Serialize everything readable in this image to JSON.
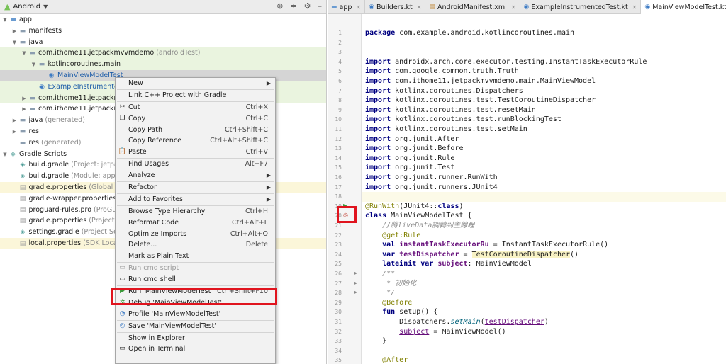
{
  "panel": {
    "title": "Android",
    "icons": {
      "android": "android-icon",
      "dropdown": "chevron-down-icon",
      "locate": "target-icon",
      "collapse": "collapse-icon",
      "settings": "gear-icon",
      "hide": "minimize-icon"
    }
  },
  "tree": [
    {
      "label": "app",
      "hint": "",
      "indent": 0,
      "arrow": "down",
      "icon": "folder-blue",
      "style": ""
    },
    {
      "label": "manifests",
      "hint": "",
      "indent": 1,
      "arrow": "right",
      "icon": "folder",
      "style": ""
    },
    {
      "label": "java",
      "hint": "",
      "indent": 1,
      "arrow": "down",
      "icon": "folder",
      "style": ""
    },
    {
      "label": "com.ithome11.jetpackmvvmdemo",
      "hint": " (androidTest)",
      "indent": 2,
      "arrow": "down",
      "icon": "pkg",
      "style": "hl-green"
    },
    {
      "label": "kotlincoroutines.main",
      "hint": "",
      "indent": 3,
      "arrow": "down",
      "icon": "pkg",
      "style": "hl-green"
    },
    {
      "label": "MainViewModelTest",
      "hint": "",
      "indent": 4,
      "arrow": "",
      "icon": "kt",
      "style": "selected"
    },
    {
      "label": "ExampleInstrumentedTest",
      "hint": "",
      "indent": 3,
      "arrow": "",
      "icon": "kt",
      "style": "hl-green"
    },
    {
      "label": "com.ithome11.jetpackmv",
      "hint": "",
      "indent": 2,
      "arrow": "right",
      "icon": "pkg",
      "style": "hl-green"
    },
    {
      "label": "com.ithome11.jetpackmv",
      "hint": "",
      "indent": 2,
      "arrow": "right",
      "icon": "pkg",
      "style": ""
    },
    {
      "label": "java",
      "hint": " (generated)",
      "indent": 1,
      "arrow": "right",
      "icon": "folder",
      "style": ""
    },
    {
      "label": "res",
      "hint": "",
      "indent": 1,
      "arrow": "right",
      "icon": "folder",
      "style": ""
    },
    {
      "label": "res",
      "hint": " (generated)",
      "indent": 1,
      "arrow": "",
      "icon": "folder",
      "style": ""
    },
    {
      "label": "Gradle Scripts",
      "hint": "",
      "indent": 0,
      "arrow": "down",
      "icon": "gradle",
      "style": ""
    },
    {
      "label": "build.gradle",
      "hint": " (Project: jetpack",
      "indent": 1,
      "arrow": "",
      "icon": "gradle",
      "style": ""
    },
    {
      "label": "build.gradle",
      "hint": " (Module: app)",
      "indent": 1,
      "arrow": "",
      "icon": "gradle",
      "style": ""
    },
    {
      "label": "gradle.properties",
      "hint": " (Global Pr",
      "indent": 1,
      "arrow": "",
      "icon": "props",
      "style": "hl-yellow"
    },
    {
      "label": "gradle-wrapper.properties",
      "hint": " (",
      "indent": 1,
      "arrow": "",
      "icon": "props",
      "style": ""
    },
    {
      "label": "proguard-rules.pro",
      "hint": " (ProGua",
      "indent": 1,
      "arrow": "",
      "icon": "props",
      "style": ""
    },
    {
      "label": "gradle.properties",
      "hint": " (Project Pr",
      "indent": 1,
      "arrow": "",
      "icon": "props",
      "style": ""
    },
    {
      "label": "settings.gradle",
      "hint": " (Project Settin",
      "indent": 1,
      "arrow": "",
      "icon": "gradle",
      "style": ""
    },
    {
      "label": "local.properties",
      "hint": " (SDK Locatio",
      "indent": 1,
      "arrow": "",
      "icon": "props",
      "style": "hl-yellow"
    }
  ],
  "menu": [
    {
      "label": "New",
      "shortcut": "",
      "submenu": true,
      "icon": "",
      "disabled": false,
      "sep": false
    },
    {
      "sep": true
    },
    {
      "label": "Link C++ Project with Gradle",
      "shortcut": "",
      "submenu": false,
      "icon": "",
      "disabled": false,
      "sep": false
    },
    {
      "sep": true
    },
    {
      "label": "Cut",
      "shortcut": "Ctrl+X",
      "submenu": false,
      "icon": "scissors-icon",
      "disabled": false,
      "sep": false
    },
    {
      "label": "Copy",
      "shortcut": "Ctrl+C",
      "submenu": false,
      "icon": "copy-icon",
      "disabled": false,
      "sep": false
    },
    {
      "label": "Copy Path",
      "shortcut": "Ctrl+Shift+C",
      "submenu": false,
      "icon": "",
      "disabled": false,
      "sep": false
    },
    {
      "label": "Copy Reference",
      "shortcut": "Ctrl+Alt+Shift+C",
      "submenu": false,
      "icon": "",
      "disabled": false,
      "sep": false
    },
    {
      "label": "Paste",
      "shortcut": "Ctrl+V",
      "submenu": false,
      "icon": "paste-icon",
      "disabled": false,
      "sep": false
    },
    {
      "sep": true
    },
    {
      "label": "Find Usages",
      "shortcut": "Alt+F7",
      "submenu": false,
      "icon": "",
      "disabled": false,
      "sep": false
    },
    {
      "label": "Analyze",
      "shortcut": "",
      "submenu": true,
      "icon": "",
      "disabled": false,
      "sep": false
    },
    {
      "sep": true
    },
    {
      "label": "Refactor",
      "shortcut": "",
      "submenu": true,
      "icon": "",
      "disabled": false,
      "sep": false
    },
    {
      "sep": true
    },
    {
      "label": "Add to Favorites",
      "shortcut": "",
      "submenu": true,
      "icon": "",
      "disabled": false,
      "sep": false
    },
    {
      "sep": true
    },
    {
      "label": "Browse Type Hierarchy",
      "shortcut": "Ctrl+H",
      "submenu": false,
      "icon": "",
      "disabled": false,
      "sep": false
    },
    {
      "label": "Reformat Code",
      "shortcut": "Ctrl+Alt+L",
      "submenu": false,
      "icon": "",
      "disabled": false,
      "sep": false
    },
    {
      "label": "Optimize Imports",
      "shortcut": "Ctrl+Alt+O",
      "submenu": false,
      "icon": "",
      "disabled": false,
      "sep": false
    },
    {
      "label": "Delete...",
      "shortcut": "Delete",
      "submenu": false,
      "icon": "",
      "disabled": false,
      "sep": false
    },
    {
      "label": "Mark as Plain Text",
      "shortcut": "",
      "submenu": false,
      "icon": "",
      "disabled": false,
      "sep": false
    },
    {
      "sep": true
    },
    {
      "label": "Run cmd script",
      "shortcut": "",
      "submenu": false,
      "icon": "terminal-icon",
      "disabled": true,
      "sep": false
    },
    {
      "label": "Run cmd shell",
      "shortcut": "",
      "submenu": false,
      "icon": "terminal-icon",
      "disabled": false,
      "sep": false
    },
    {
      "sep": true
    },
    {
      "label": "Run 'MainViewModelTest'",
      "shortcut": "Ctrl+Shift+F10",
      "submenu": false,
      "icon": "run-icon",
      "disabled": false,
      "sep": false
    },
    {
      "label": "Debug 'MainViewModelTest'",
      "shortcut": "",
      "submenu": false,
      "icon": "debug-icon",
      "disabled": false,
      "sep": false
    },
    {
      "label": "Profile 'MainViewModelTest'",
      "shortcut": "",
      "submenu": false,
      "icon": "profile-icon",
      "disabled": false,
      "sep": false
    },
    {
      "sep": true
    },
    {
      "label": "Save 'MainViewModelTest'",
      "shortcut": "",
      "submenu": false,
      "icon": "save-icon",
      "disabled": false,
      "sep": false
    },
    {
      "sep": true
    },
    {
      "label": "Show in Explorer",
      "shortcut": "",
      "submenu": false,
      "icon": "",
      "disabled": false,
      "sep": false
    },
    {
      "label": "Open in Terminal",
      "shortcut": "",
      "submenu": false,
      "icon": "terminal-icon",
      "disabled": false,
      "sep": false
    }
  ],
  "tabs": [
    {
      "label": "app",
      "icon": "module-icon",
      "active": false
    },
    {
      "label": "Builders.kt",
      "icon": "kotlin-file-icon",
      "active": false
    },
    {
      "label": "AndroidManifest.xml",
      "icon": "xml-file-icon",
      "active": false
    },
    {
      "label": "ExampleInstrumentedTest.kt",
      "icon": "kotlin-file-icon",
      "active": false
    },
    {
      "label": "MainViewModelTest.kt",
      "icon": "kotlin-file-icon",
      "active": true
    }
  ],
  "code": [
    {
      "n": "1",
      "html": "<span class=\"kw\">package</span> com.example.android.kotlincoroutines.main"
    },
    {
      "n": "2",
      "html": ""
    },
    {
      "n": "3",
      "html": ""
    },
    {
      "n": "4",
      "html": "<span class=\"kw\">import</span> androidx.arch.core.executor.testing.InstantTaskExecutorRule"
    },
    {
      "n": "5",
      "html": "<span class=\"kw\">import</span> com.google.common.truth.Truth"
    },
    {
      "n": "6",
      "html": "<span class=\"kw\">import</span> com.ithome11.jetpackmvvmdemo.main.MainViewModel"
    },
    {
      "n": "7",
      "html": "<span class=\"kw\">import</span> kotlinx.coroutines.Dispatchers"
    },
    {
      "n": "8",
      "html": "<span class=\"kw\">import</span> kotlinx.coroutines.test.TestCoroutineDispatcher"
    },
    {
      "n": "9",
      "html": "<span class=\"kw\">import</span> kotlinx.coroutines.test.resetMain"
    },
    {
      "n": "10",
      "html": "<span class=\"kw\">import</span> kotlinx.coroutines.test.runBlockingTest"
    },
    {
      "n": "11",
      "html": "<span class=\"kw\">import</span> kotlinx.coroutines.test.setMain"
    },
    {
      "n": "12",
      "html": "<span class=\"kw\">import</span> org.junit.After"
    },
    {
      "n": "13",
      "html": "<span class=\"kw\">import</span> org.junit.Before"
    },
    {
      "n": "14",
      "html": "<span class=\"kw\">import</span> org.junit.Rule"
    },
    {
      "n": "15",
      "html": "<span class=\"kw\">import</span> org.junit.Test"
    },
    {
      "n": "16",
      "html": "<span class=\"kw\">import</span> org.junit.runner.RunWith"
    },
    {
      "n": "17",
      "html": "<span class=\"kw\">import</span> org.junit.runners.JUnit4"
    },
    {
      "n": "18",
      "html": "",
      "hl": true
    },
    {
      "n": "19",
      "html": "<span class=\"ann\">@RunWith</span>(JUnit4::<span class=\"kw\">class</span>)"
    },
    {
      "n": "20",
      "html": "<span class=\"kw\">class</span> MainViewModelTest {"
    },
    {
      "n": "21",
      "html": "    <span class=\"cm\">//將liveData調轉到主線程</span>"
    },
    {
      "n": "22",
      "html": "    <span class=\"ann\">@get:Rule</span>"
    },
    {
      "n": "23",
      "html": "    <span class=\"kw\">val</span> <span class=\"prop\">instantTaskExecutorRu</span> = InstantTaskExecutorRule()"
    },
    {
      "n": "24",
      "html": "    <span class=\"kw\">var</span> <span class=\"prop\">testDispatcher</span> = <span class=\"hlbox\">TestCoroutineDispatcher</span>()"
    },
    {
      "n": "25",
      "html": "    <span class=\"kw\">lateinit var</span> <span class=\"prop\">subject</span>: MainViewModel"
    },
    {
      "n": "26",
      "html": "    <span class=\"cm\">/**</span>"
    },
    {
      "n": "27",
      "html": "    <span class=\"cm\"> * 初始化</span>"
    },
    {
      "n": "28",
      "html": "    <span class=\"cm\"> */</span>"
    },
    {
      "n": "29",
      "html": "    <span class=\"ann\">@Before</span>"
    },
    {
      "n": "30",
      "html": "    <span class=\"kw\">fun</span> setup() {"
    },
    {
      "n": "31",
      "html": "        Dispatchers.<span class=\"ital\">setMain</span>(<span class=\"under\">testDispatcher</span>)"
    },
    {
      "n": "32",
      "html": "        <span class=\"under\">subject</span> = MainViewModel()"
    },
    {
      "n": "33",
      "html": "    }"
    },
    {
      "n": "34",
      "html": ""
    },
    {
      "n": "35",
      "html": "    <span class=\"ann\">@After</span>"
    }
  ]
}
